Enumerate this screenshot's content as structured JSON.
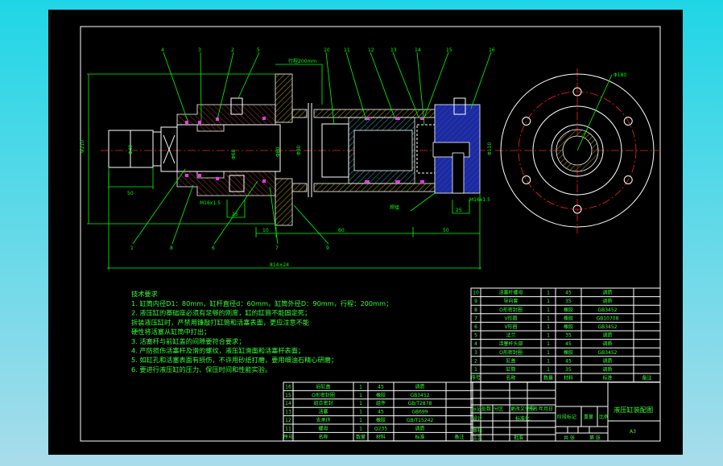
{
  "drawing": {
    "title": "液压缸装配图",
    "sheet_size": "A3",
    "balloons_top": [
      "4",
      "3",
      "2",
      "5",
      "10",
      "11",
      "12",
      "13",
      "14",
      "15",
      "16"
    ],
    "balloons_bottom": [
      "1",
      "8",
      "6",
      "7",
      "9"
    ],
    "dimensions": {
      "stroke": "行程200mm",
      "phi_outer": "Φ210",
      "rod_end": "50",
      "rod_end_dia": "Φ40",
      "port_left": "M16x1.5",
      "port_right": "M16x1.5",
      "port_pitch_left": "25",
      "port_pitch_right": "25",
      "rod_dia": "Φ60",
      "piston_dia": "Φ80",
      "tube_dia": "Φ90",
      "cap_dia": "Φ110",
      "seg1": "10",
      "seg2": "60",
      "seg3": "50",
      "total": "814±24",
      "weld": "焊接",
      "pcd": "Φ180"
    }
  },
  "notes": {
    "heading": "技术要求",
    "lines": [
      "1. 缸筒内径D1：80mm，缸杆直径d：60mm，缸筒外径D：90mm，行程：200mm；",
      "2. 液压缸的基础座必须有足够的刚度，缸的缸筒不能固定死；",
      "拆装液压缸时，严禁用锤敲打缸筒和活塞表面，更应注意不能",
      "硬性将活塞从缸筒中打出；",
      "3. 活塞杆与前缸盖的间隙要符合要求；",
      "4. 严防损伤活塞杆及滑的螺纹，液压缸滑面和活塞杆表面；",
      "5. 如缸孔和活塞表面有损伤，不许用砂纸打磨，要用细油石精心研磨；",
      "6. 要进行液压缸的压力、保压时间和性能实验。"
    ]
  },
  "parts_right": {
    "header": [
      "序号",
      "名称",
      "数量",
      "材料",
      "标准",
      "备注"
    ],
    "rows": [
      [
        "10",
        "活塞杆螺母",
        "1",
        "45",
        "调质",
        ""
      ],
      [
        "9",
        "导向套",
        "1",
        "35",
        "调质",
        ""
      ],
      [
        "8",
        "O形密封圈",
        "1",
        "橡胶",
        "GB3452",
        ""
      ],
      [
        "7",
        "V形圈",
        "1",
        "橡胶",
        "GB10708",
        ""
      ],
      [
        "6",
        "V形圈",
        "1",
        "橡胶",
        "GB3452",
        ""
      ],
      [
        "5",
        "法兰",
        "1",
        "35",
        "调质",
        ""
      ],
      [
        "4",
        "活塞杆头部",
        "1",
        "45",
        "调质",
        ""
      ],
      [
        "3",
        "O形密封圈",
        "1",
        "橡胶",
        "GB3452",
        ""
      ],
      [
        "2",
        "缸盖",
        "1",
        "45",
        "调质",
        ""
      ],
      [
        "1",
        "缸筒",
        "1",
        "35",
        "调质",
        ""
      ]
    ]
  },
  "parts_left": {
    "header": [
      "序号",
      "名称",
      "数量",
      "材料",
      "标准",
      "备注"
    ],
    "rows": [
      [
        "16",
        "后缸盖",
        "1",
        "45",
        "调质",
        ""
      ],
      [
        "15",
        "O形密封圈",
        "1",
        "橡胶",
        "GB3452",
        ""
      ],
      [
        "14",
        "组合密封",
        "1",
        "组件",
        "GB/T2878",
        ""
      ],
      [
        "13",
        "活塞",
        "1",
        "45",
        "GB699",
        ""
      ],
      [
        "12",
        "支承环",
        "1",
        "橡胶",
        "GB/T15242",
        ""
      ],
      [
        "11",
        "螺母",
        "1",
        "Q235",
        "调质",
        ""
      ]
    ]
  },
  "title_block": {
    "rev_labels": [
      "标记",
      "处数",
      "分区",
      "更改文件号",
      "签名",
      "年月日"
    ],
    "design": "设计",
    "standard": "标准化",
    "review": "审核",
    "process": "工艺",
    "approve": "批准",
    "stage": "阶段标记",
    "weight": "重量",
    "scale": "比例",
    "sheets_total": "共 张",
    "sheet_no": "第 张",
    "drawing_title": "液压缸装配图",
    "drawing_no": "A3"
  }
}
